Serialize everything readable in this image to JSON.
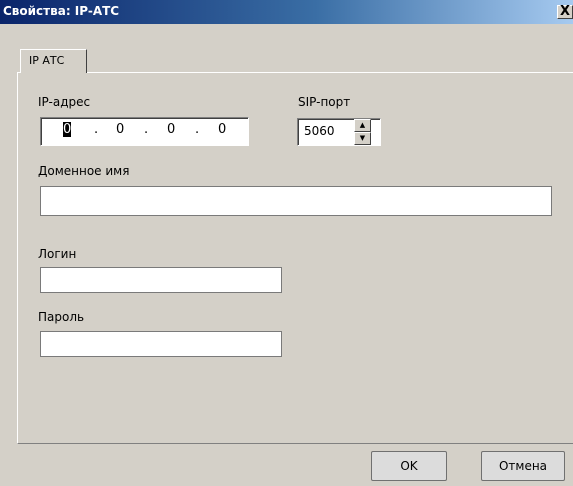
{
  "window": {
    "title": "Свойства: IP-АТС",
    "close_glyph": "X"
  },
  "tabs": [
    {
      "label": "IP АТС",
      "selected": true
    }
  ],
  "form": {
    "ip_label": "IP-адрес",
    "ip_octets": [
      "0",
      "0",
      "0",
      "0"
    ],
    "ip_separator": ".",
    "sip_label": "SIP-порт",
    "sip_port_value": "5060",
    "domain_label": "Доменное имя",
    "domain_value": "",
    "login_label": "Логин",
    "login_value": "",
    "password_label": "Пароль",
    "password_value": ""
  },
  "buttons": {
    "ok": "OK",
    "cancel": "Отмена"
  },
  "icons": {
    "close": "close-icon",
    "spin_up": "spin-up-icon",
    "spin_down": "spin-down-icon"
  }
}
